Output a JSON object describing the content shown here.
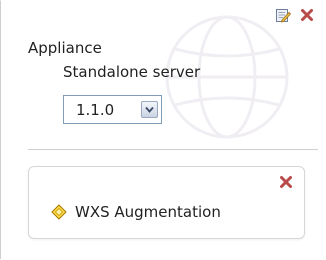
{
  "appliance": {
    "label": "Appliance",
    "type": "Standalone server"
  },
  "version_select": {
    "selected": "1.1.0"
  },
  "augmentation": {
    "label": "WXS Augmentation"
  },
  "icons": {
    "edit": "edit-icon",
    "close": "close-icon",
    "dropdown": "chevron-down-icon",
    "augmentation": "diamond-icon",
    "watermark": "globe-watermark-icon"
  },
  "colors": {
    "close": "#b84a4a",
    "border": "#cfcfcf",
    "select_border": "#7f9db9",
    "diamond": "#e6b800"
  }
}
